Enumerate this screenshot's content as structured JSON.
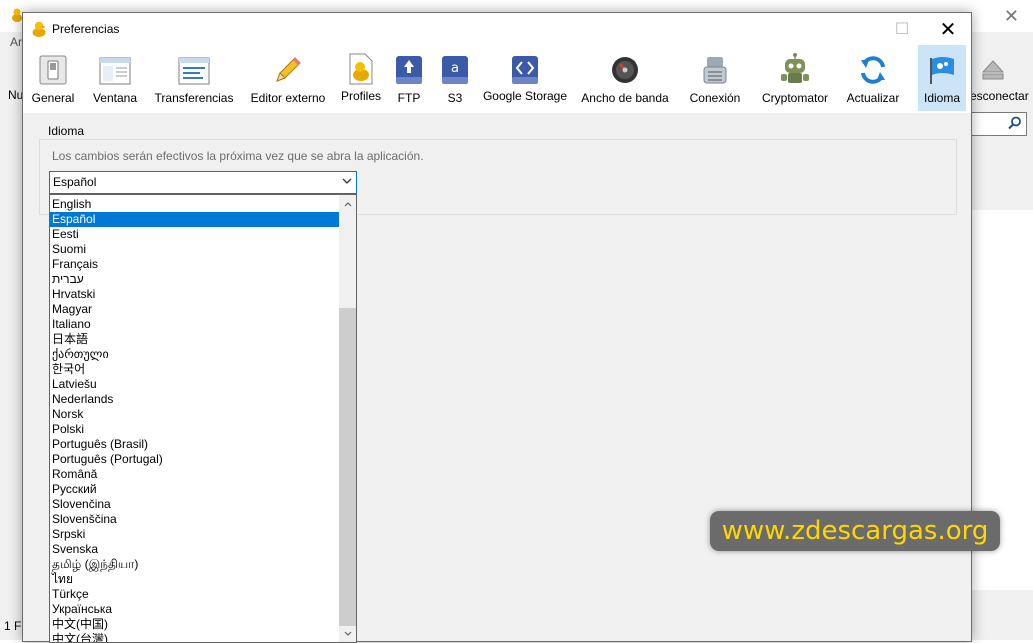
{
  "background_window": {
    "left_label_top": "Ar",
    "left_label_new": "Nu",
    "left_label_bottom": "1 F",
    "disconnect_label": "esconectar",
    "close_glyph": "✕"
  },
  "dialog": {
    "title": "Preferencias",
    "close_glyph": "✕",
    "maximize_glyph": "☐"
  },
  "toolbar": {
    "items": [
      {
        "label": "General",
        "icon": "switch-icon"
      },
      {
        "label": "Ventana",
        "icon": "window-icon"
      },
      {
        "label": "Transferencias",
        "icon": "transfers-window-icon"
      },
      {
        "label": "Editor externo",
        "icon": "pencil-icon"
      },
      {
        "label": "Profiles",
        "icon": "duck-document-icon"
      },
      {
        "label": "FTP",
        "icon": "ftp-drive-icon"
      },
      {
        "label": "S3",
        "icon": "amazon-drive-icon"
      },
      {
        "label": "Google Storage",
        "icon": "google-storage-drive-icon"
      },
      {
        "label": "Ancho de banda",
        "icon": "bandwidth-disc-icon"
      },
      {
        "label": "Conexión",
        "icon": "connection-icon"
      },
      {
        "label": "Cryptomator",
        "icon": "cryptomator-robot-icon"
      },
      {
        "label": "Actualizar",
        "icon": "update-arrows-icon"
      },
      {
        "label": "Idioma",
        "icon": "language-flag-icon"
      }
    ],
    "active": "Idioma"
  },
  "language_section": {
    "legend": "Idioma",
    "hint": "Los cambios serán efectivos la próxima vez que se abra la aplicación.",
    "selected": "Español",
    "options": [
      "English",
      "Español",
      "Eesti",
      "Suomi",
      "Français",
      "עברית",
      "Hrvatski",
      "Magyar",
      "Italiano",
      "日本語",
      "ქართული",
      "한국어",
      "Latviešu",
      "Nederlands",
      "Norsk",
      "Polski",
      "Português (Brasil)",
      "Português (Portugal)",
      "Română",
      "Русский",
      "Slovenčina",
      "Slovenščina",
      "Srpski",
      "Svenska",
      "தமிழ் (இந்தியா)",
      "ไทย",
      "Türkçe",
      "Українська",
      "中文(中国)",
      "中文(台灣)"
    ]
  },
  "watermark": {
    "text": "www.zdescargas.org"
  },
  "colors": {
    "accent": "#0078d7",
    "active_tab": "#cce4f7",
    "watermark_text": "#ffd600"
  }
}
